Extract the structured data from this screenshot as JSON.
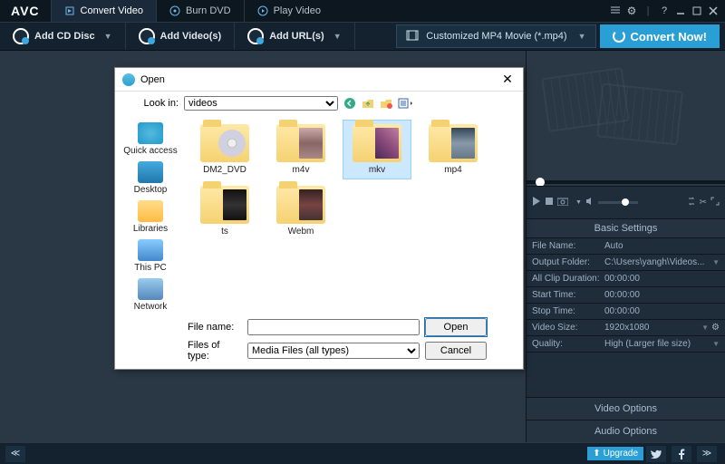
{
  "app": {
    "logo": "AVC"
  },
  "top_tabs": {
    "convert": "Convert Video",
    "burn": "Burn DVD",
    "play": "Play Video"
  },
  "toolbar": {
    "add_disc": "Add CD Disc",
    "add_videos": "Add Video(s)",
    "add_urls": "Add URL(s)",
    "format": "Customized MP4 Movie (*.mp4)",
    "convert": "Convert Now!"
  },
  "dialog": {
    "title": "Open",
    "look_in_label": "Look in:",
    "look_in_value": "videos",
    "side": {
      "quick": "Quick access",
      "desktop": "Desktop",
      "libraries": "Libraries",
      "thispc": "This PC",
      "network": "Network"
    },
    "folders": {
      "dm2": "DM2_DVD",
      "m4v": "m4v",
      "mkv": "mkv",
      "mp4": "mp4",
      "ts": "ts",
      "webm": "Webm"
    },
    "file_name_label": "File name:",
    "file_name_value": "",
    "files_of_type_label": "Files of type:",
    "files_of_type_value": "Media Files (all types)",
    "open_btn": "Open",
    "cancel_btn": "Cancel"
  },
  "settings": {
    "header": "Basic Settings",
    "rows": {
      "file_name": {
        "label": "File Name:",
        "value": "Auto"
      },
      "output_folder": {
        "label": "Output Folder:",
        "value": "C:\\Users\\yangh\\Videos..."
      },
      "clip_duration": {
        "label": "All Clip Duration:",
        "value": "00:00:00"
      },
      "start_time": {
        "label": "Start Time:",
        "value": "00:00:00"
      },
      "stop_time": {
        "label": "Stop Time:",
        "value": "00:00:00"
      },
      "video_size": {
        "label": "Video Size:",
        "value": "1920x1080"
      },
      "quality": {
        "label": "Quality:",
        "value": "High (Larger file size)"
      }
    },
    "video_options": "Video Options",
    "audio_options": "Audio Options"
  },
  "bottom": {
    "upgrade": "Upgrade"
  }
}
